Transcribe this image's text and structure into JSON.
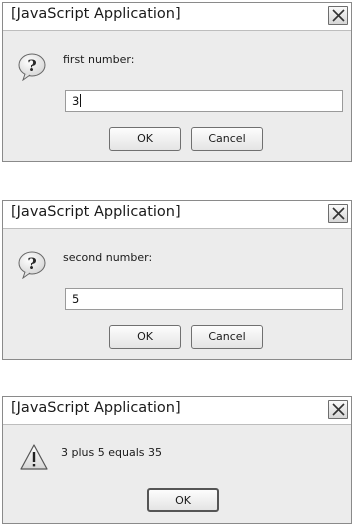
{
  "dialogs": [
    {
      "title": "[JavaScript Application]",
      "icon": "question-icon",
      "prompt": "first number:",
      "input_value": "3",
      "ok_label": "OK",
      "cancel_label": "Cancel"
    },
    {
      "title": "[JavaScript Application]",
      "icon": "question-icon",
      "prompt": "second number:",
      "input_value": "5",
      "ok_label": "OK",
      "cancel_label": "Cancel"
    },
    {
      "title": "[JavaScript Application]",
      "icon": "warning-icon",
      "message": "3 plus 5 equals 35",
      "ok_label": "OK"
    }
  ],
  "colors": {
    "dialog_bg": "#ececec",
    "titlebar_bg": "#ffffff",
    "border": "#8a8a8a"
  }
}
